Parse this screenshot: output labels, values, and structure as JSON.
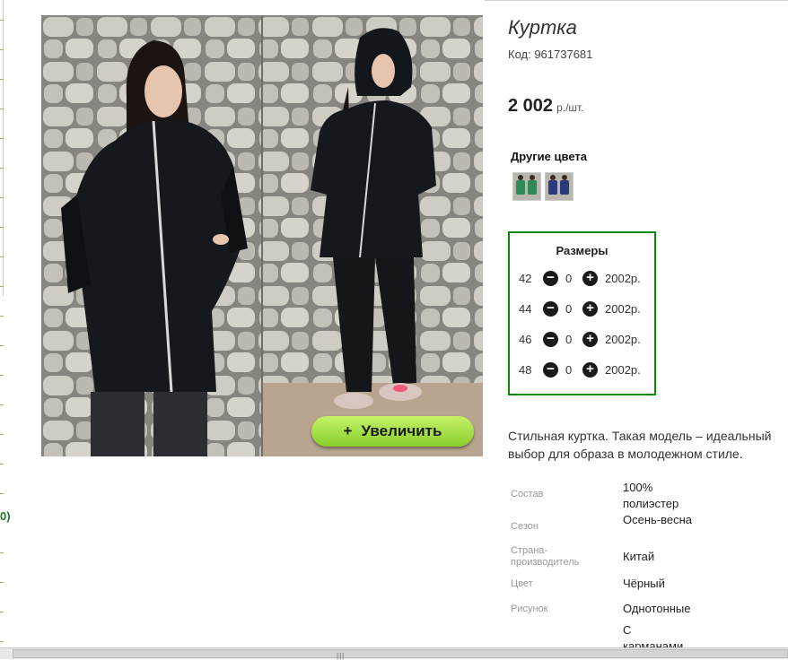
{
  "side_fragment": "0)",
  "product": {
    "title": "Куртка",
    "code": "Код: 961737681",
    "price": "2 002",
    "price_unit": "р./шт."
  },
  "zoom_button": {
    "icon": "+",
    "label": "Увеличить"
  },
  "other_colors": {
    "title": "Другие цвета",
    "swatches": [
      {
        "name": "green",
        "color": "#2e8b57"
      },
      {
        "name": "navy",
        "color": "#2a3a7a"
      }
    ]
  },
  "sizes": {
    "title": "Размеры",
    "rows": [
      {
        "size": "42",
        "minus": "−",
        "count": "0",
        "plus": "+",
        "price": "2002р."
      },
      {
        "size": "44",
        "minus": "−",
        "count": "0",
        "plus": "+",
        "price": "2002р."
      },
      {
        "size": "46",
        "minus": "−",
        "count": "0",
        "plus": "+",
        "price": "2002р."
      },
      {
        "size": "48",
        "minus": "−",
        "count": "0",
        "plus": "+",
        "price": "2002р."
      }
    ]
  },
  "description": "Стильная куртка. Такая модель – идеальный выбор для образа в молодежном стиле.",
  "attributes": [
    {
      "label": "Состав",
      "value": "100% полиэстер"
    },
    {
      "label": "Сезон",
      "value": "Осень-весна"
    },
    {
      "label": "Страна-производитель",
      "value": "Китай"
    },
    {
      "label": "Цвет",
      "value": "Чёрный"
    },
    {
      "label": "Рисунок",
      "value": "Однотонные"
    },
    {
      "label": "",
      "value": "С карманами"
    }
  ],
  "colors": {
    "sizes_border": "#0a8a0a",
    "zoom_button_top": "#c6f16a",
    "zoom_button_bottom": "#88cf2c"
  }
}
